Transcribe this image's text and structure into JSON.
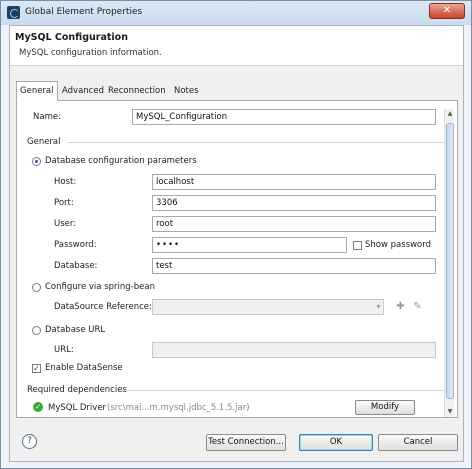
{
  "window": {
    "title": "Global Element Properties",
    "close_glyph": "✕"
  },
  "header": {
    "title": "MySQL Configuration",
    "subtitle": "MySQL configuration information."
  },
  "tabs": [
    {
      "label": "General",
      "active": true
    },
    {
      "label": "Advanced",
      "active": false
    },
    {
      "label": "Reconnection",
      "active": false
    },
    {
      "label": "Notes",
      "active": false
    }
  ],
  "form": {
    "name_label": "Name:",
    "name_value": "MySQL_Configuration",
    "general_section": "General",
    "db_params": {
      "label": "Database configuration parameters",
      "selected": true,
      "host_label": "Host:",
      "host_value": "localhost",
      "port_label": "Port:",
      "port_value": "3306",
      "user_label": "User:",
      "user_value": "root",
      "password_label": "Password:",
      "password_value": "••••",
      "show_password_label": "Show password",
      "show_password_checked": false,
      "database_label": "Database:",
      "database_value": "test"
    },
    "spring_bean": {
      "label": "Configure via spring-bean",
      "selected": false,
      "datasource_label": "DataSource Reference:",
      "datasource_value": ""
    },
    "db_url": {
      "label": "Database URL",
      "selected": false,
      "url_label": "URL:",
      "url_value": ""
    },
    "datasense": {
      "label": "Enable DataSense",
      "checked": true
    },
    "dependencies": {
      "section": "Required dependencies",
      "driver_name": "MySQL Driver",
      "driver_path": "(src\\mai...m.mysql.jdbc_5.1.5.jar)",
      "modify_label": "Modify"
    }
  },
  "footer": {
    "help_glyph": "?",
    "test_connection_label": "Test Connection...",
    "ok_label": "OK",
    "cancel_label": "Cancel"
  },
  "icons": {
    "add": "✚",
    "edit": "✎",
    "dropdown": "▾",
    "scroll_up": "▲",
    "scroll_down": "▼",
    "check": "✓"
  },
  "colors": {
    "ok_green": "#3ea63e",
    "accent_blue": "#3c7fb1",
    "close_red": "#c7442d"
  }
}
